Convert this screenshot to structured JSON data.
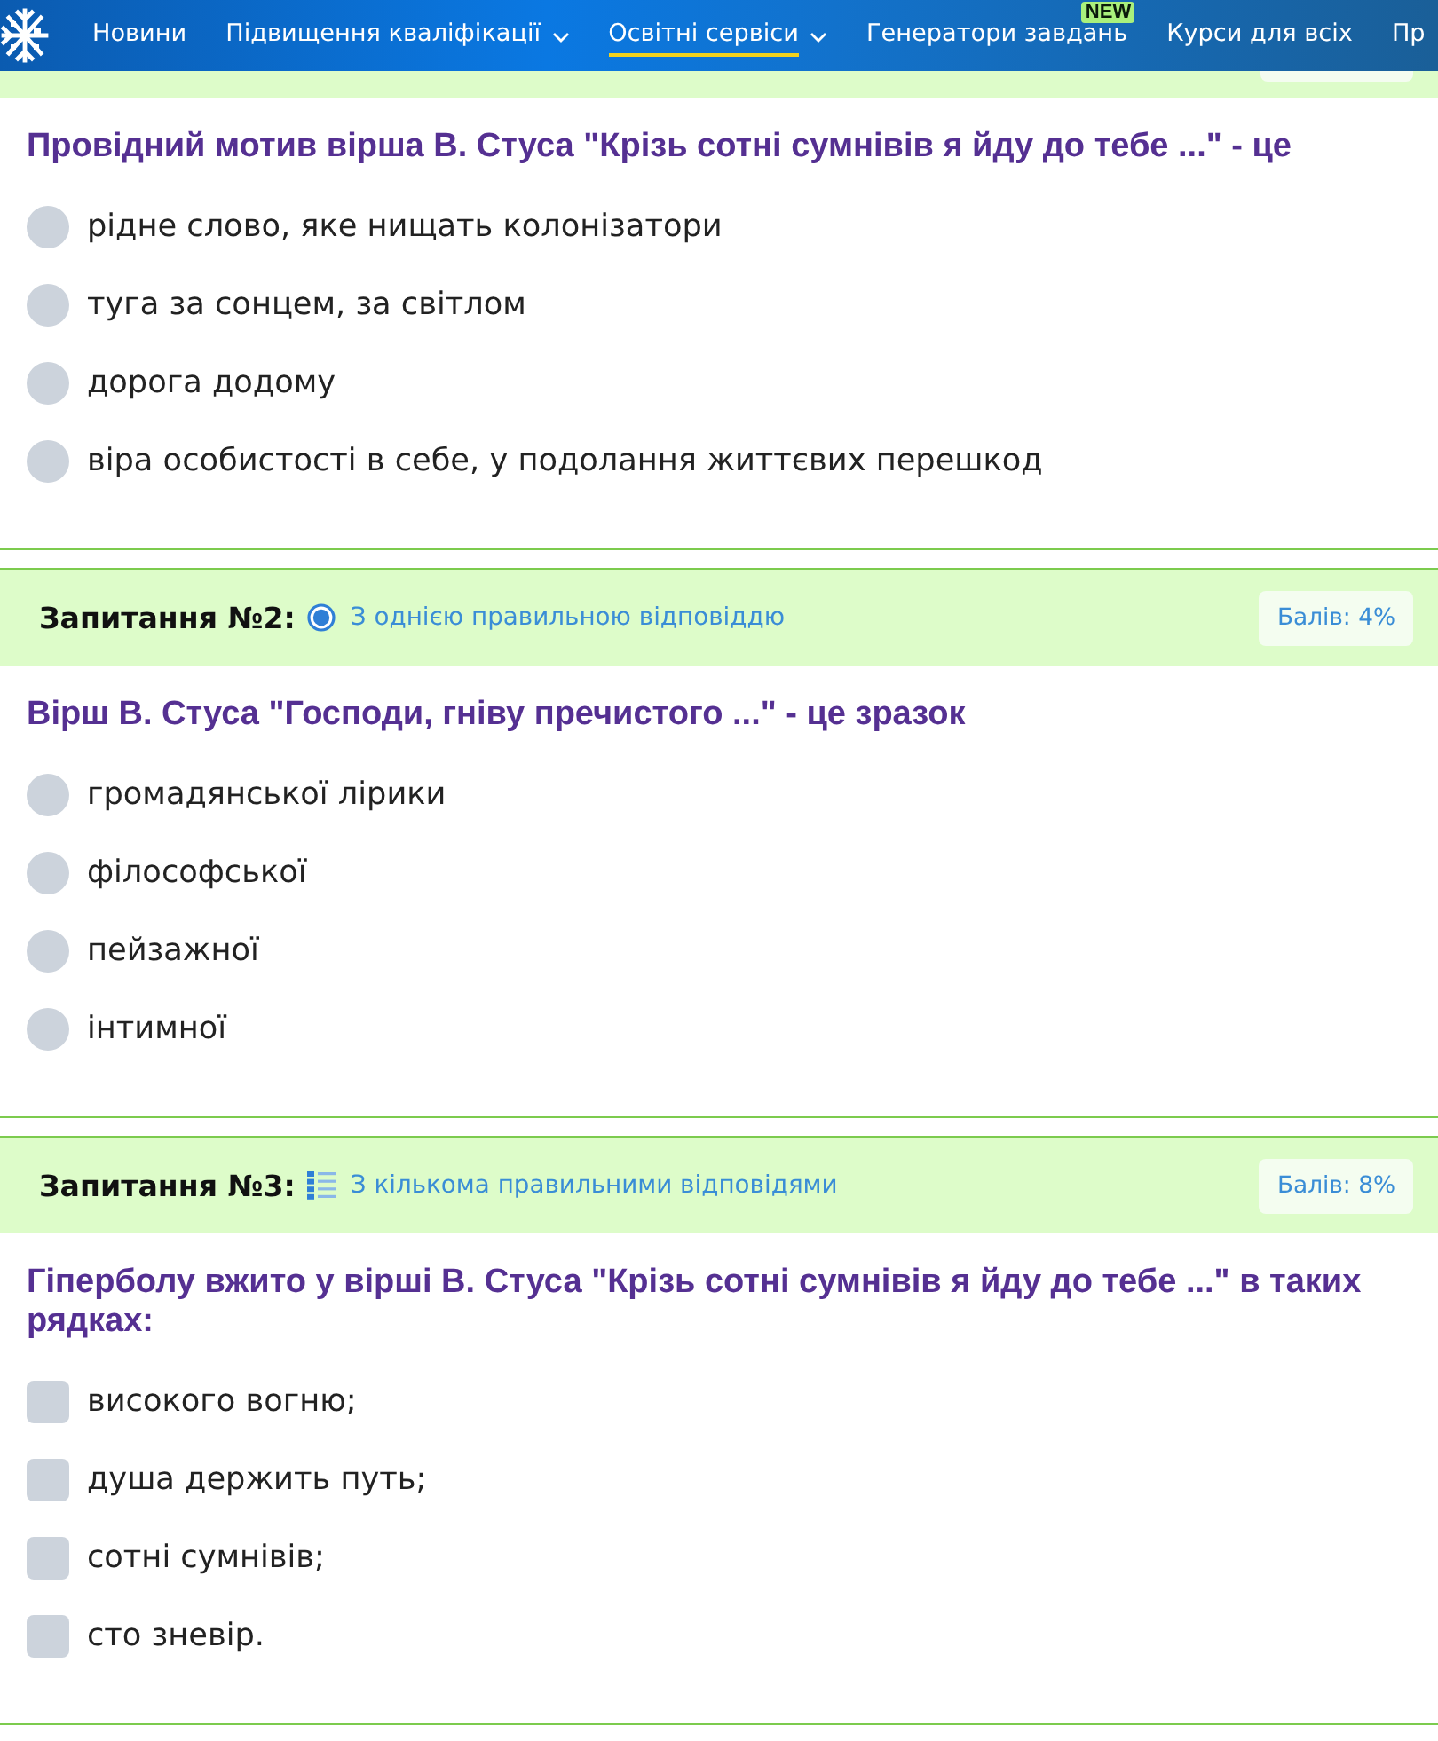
{
  "nav": {
    "items": [
      {
        "label": "Новини",
        "selected": false,
        "dropdown": false
      },
      {
        "label": "Підвищення кваліфікації",
        "selected": false,
        "dropdown": true
      },
      {
        "label": "Освітні сервіси",
        "selected": true,
        "dropdown": true
      },
      {
        "label": "Генератори завдань",
        "selected": false,
        "dropdown": false,
        "badge": "NEW"
      },
      {
        "label": "Курси для всіх",
        "selected": false,
        "dropdown": false
      },
      {
        "label": "Пр",
        "selected": false,
        "dropdown": false
      }
    ]
  },
  "questions": [
    {
      "kind": "single",
      "text": "Провідний мотив вірша В. Стуса \"Крізь сотні сумнівів я йду до тебе ...\" - це",
      "options": [
        {
          "label": "рідне слово, яке нищать колонізатори",
          "selected": false
        },
        {
          "label": "туга за сонцем, за світлом",
          "selected": false
        },
        {
          "label": "дорога додому",
          "selected": false
        },
        {
          "label": "віра особистості в себе, у подолання життєвих перешкод",
          "selected": false
        }
      ]
    },
    {
      "kind": "single",
      "header": {
        "title": "Запитання №2:",
        "type_label": "З однією правильною відповіддю",
        "score": "Балів: 4%"
      },
      "text": "Вірш В. Стуса \"Господи, гніву пречистого ...\" - це зразок",
      "options": [
        {
          "label": "громадянської лірики",
          "selected": false
        },
        {
          "label": "філософської",
          "selected": false
        },
        {
          "label": "пейзажної",
          "selected": false
        },
        {
          "label": "інтимної",
          "selected": false
        }
      ]
    },
    {
      "kind": "multiple",
      "header": {
        "title": "Запитання №3:",
        "type_label": "З кількома правильними відповідями",
        "score": "Балів: 8%"
      },
      "text": "Гіперболу вжито у вірші В. Стуса \"Крізь сотні сумнівів я йду до тебе ...\" в таких рядках:",
      "options": [
        {
          "label": "високого вогню;",
          "checked": false
        },
        {
          "label": "душа держить путь;",
          "checked": false
        },
        {
          "label": "сотні сумнівів;",
          "checked": false
        },
        {
          "label": "сто зневір.",
          "checked": false
        }
      ]
    }
  ]
}
